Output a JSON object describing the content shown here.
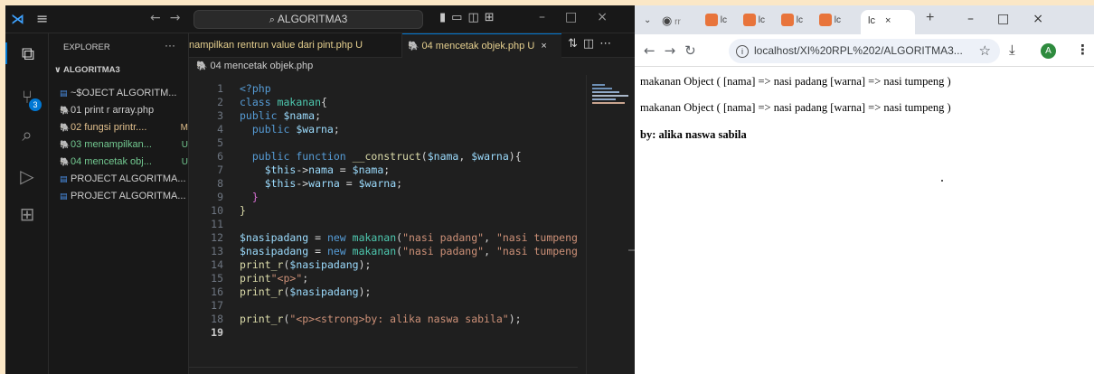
{
  "vscode": {
    "menu_icon": "≡",
    "search_text": "ALGORITMA3",
    "activity_badge": "3",
    "explorer": {
      "header": "EXPLORER",
      "more": "···",
      "folder": "∨ ALGORITMA3",
      "items": [
        {
          "label": "~$OJECT ALGORITM...",
          "status": "",
          "icon": "word-file-icon",
          "color": "#cccccc"
        },
        {
          "label": "01 print r array.php",
          "status": "",
          "icon": "php-file-icon",
          "color": "#cccccc"
        },
        {
          "label": "02 fungsi printr....",
          "status": "M",
          "icon": "php-file-icon",
          "color": "#e2c08d"
        },
        {
          "label": "03 menampilkan...",
          "status": "U",
          "icon": "php-file-icon",
          "color": "#73c991"
        },
        {
          "label": "04 mencetak obj...",
          "status": "U",
          "icon": "php-file-icon",
          "color": "#73c991"
        },
        {
          "label": "PROJECT ALGORITMA...",
          "status": "",
          "icon": "word-file-icon",
          "color": "#cccccc"
        },
        {
          "label": "PROJECT ALGORITMA...",
          "status": "",
          "icon": "word-file-icon",
          "color": "#cccccc"
        }
      ]
    },
    "tabs": [
      {
        "label": "nampilkan rentrun value dari pint.php",
        "status": "U"
      },
      {
        "label": "04 mencetak objek.php",
        "status": "U",
        "close": "×"
      }
    ],
    "breadcrumb": "04 mencetak objek.php",
    "current_line": 19,
    "code_lines": [
      [
        {
          "t": "<?php",
          "c": "k"
        }
      ],
      [
        {
          "t": "class ",
          "c": "k"
        },
        {
          "t": "makanan",
          "c": "cn"
        },
        {
          "t": "{",
          "c": "p"
        }
      ],
      [
        {
          "t": "public ",
          "c": "k"
        },
        {
          "t": "$nama",
          "c": "v"
        },
        {
          "t": ";",
          "c": "p"
        }
      ],
      [
        {
          "t": "  public ",
          "c": "k"
        },
        {
          "t": "$warna",
          "c": "v"
        },
        {
          "t": ";",
          "c": "p"
        }
      ],
      [],
      [
        {
          "t": "  public ",
          "c": "k"
        },
        {
          "t": "function ",
          "c": "k"
        },
        {
          "t": "__construct",
          "c": "f"
        },
        {
          "t": "(",
          "c": "p"
        },
        {
          "t": "$nama",
          "c": "v"
        },
        {
          "t": ", ",
          "c": "p"
        },
        {
          "t": "$warna",
          "c": "v"
        },
        {
          "t": "){",
          "c": "p"
        }
      ],
      [
        {
          "t": "    $this",
          "c": "v"
        },
        {
          "t": "->",
          "c": "p"
        },
        {
          "t": "nama",
          "c": "v"
        },
        {
          "t": " = ",
          "c": "p"
        },
        {
          "t": "$nama",
          "c": "v"
        },
        {
          "t": ";",
          "c": "p"
        }
      ],
      [
        {
          "t": "    $this",
          "c": "v"
        },
        {
          "t": "->",
          "c": "p"
        },
        {
          "t": "warna",
          "c": "v"
        },
        {
          "t": " = ",
          "c": "p"
        },
        {
          "t": "$warna",
          "c": "v"
        },
        {
          "t": ";",
          "c": "p"
        }
      ],
      [
        {
          "t": "  }",
          "c": "pl"
        }
      ],
      [
        {
          "t": "}",
          "c": "f"
        }
      ],
      [],
      [
        {
          "t": "$nasipadang",
          "c": "v"
        },
        {
          "t": " = ",
          "c": "p"
        },
        {
          "t": "new ",
          "c": "k"
        },
        {
          "t": "makanan",
          "c": "cn"
        },
        {
          "t": "(",
          "c": "p"
        },
        {
          "t": "\"nasi padang\"",
          "c": "s"
        },
        {
          "t": ", ",
          "c": "p"
        },
        {
          "t": "\"nasi tumpeng",
          "c": "s"
        }
      ],
      [
        {
          "t": "$nasipadang",
          "c": "v"
        },
        {
          "t": " = ",
          "c": "p"
        },
        {
          "t": "new ",
          "c": "k"
        },
        {
          "t": "makanan",
          "c": "cn"
        },
        {
          "t": "(",
          "c": "p"
        },
        {
          "t": "\"nasi padang\"",
          "c": "s"
        },
        {
          "t": ", ",
          "c": "p"
        },
        {
          "t": "\"nasi tumpeng",
          "c": "s"
        }
      ],
      [
        {
          "t": "print_r",
          "c": "f"
        },
        {
          "t": "(",
          "c": "p"
        },
        {
          "t": "$nasipadang",
          "c": "v"
        },
        {
          "t": ");",
          "c": "p"
        }
      ],
      [
        {
          "t": "print",
          "c": "f"
        },
        {
          "t": "\"<p>\"",
          "c": "s"
        },
        {
          "t": ";",
          "c": "p"
        }
      ],
      [
        {
          "t": "print_r",
          "c": "f"
        },
        {
          "t": "(",
          "c": "p"
        },
        {
          "t": "$nasipadang",
          "c": "v"
        },
        {
          "t": ");",
          "c": "p"
        }
      ],
      [],
      [
        {
          "t": "print_r",
          "c": "f"
        },
        {
          "t": "(",
          "c": "p"
        },
        {
          "t": "\"<p><strong>by: alika naswa sabila\"",
          "c": "s"
        },
        {
          "t": ");",
          "c": "p"
        }
      ],
      []
    ],
    "colors": {
      "accent": "#0078d4",
      "bg": "#1f1f1f",
      "sidebar_bg": "#181818"
    }
  },
  "chrome": {
    "tab_close": "×",
    "new_tab": "+",
    "active_tab_label": "lc",
    "url": "localhost/XI%20RPL%202/ALGORITMA3...",
    "avatar_letter": "A",
    "page_lines": [
      "makanan Object ( [nama] => nasi padang [warna] => nasi tumpeng )",
      "makanan Object ( [nama] => nasi padang [warna] => nasi tumpeng )"
    ],
    "page_strong": "by: alika naswa sabila"
  }
}
